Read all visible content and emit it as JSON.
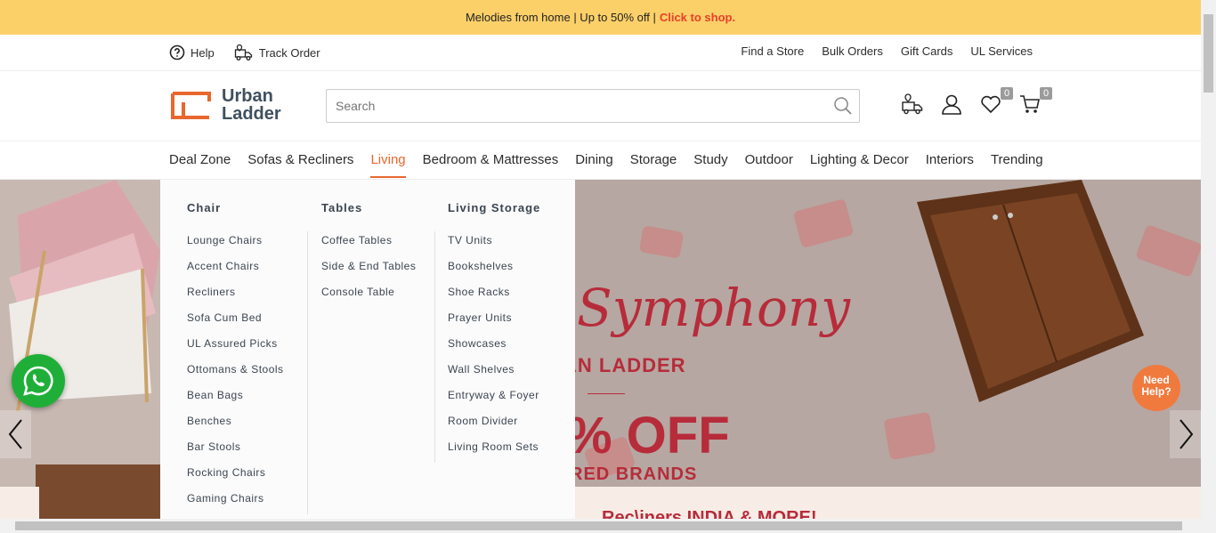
{
  "promo": {
    "text": "Melodies from home | Up to 50% off |",
    "cta": "Click to shop."
  },
  "util": {
    "help": "Help",
    "track_order": "Track Order",
    "links": [
      "Find a Store",
      "Bulk Orders",
      "Gift Cards",
      "UL Services"
    ]
  },
  "logo": {
    "line1": "Urban",
    "line2": "Ladder"
  },
  "search": {
    "placeholder": "Search"
  },
  "header_icons": {
    "wishlist_count": "0",
    "cart_count": "0"
  },
  "nav": {
    "items": [
      "Deal Zone",
      "Sofas & Recliners",
      "Living",
      "Bedroom & Mattresses",
      "Dining",
      "Storage",
      "Study",
      "Outdoor",
      "Lighting & Decor",
      "Interiors",
      "Trending"
    ],
    "active": "Living"
  },
  "mega_menu": {
    "columns": [
      {
        "title": "Chair",
        "items": [
          "Lounge Chairs",
          "Accent Chairs",
          "Recliners",
          "Sofa Cum Bed",
          "UL Assured Picks",
          "Ottomans & Stools",
          "Bean Bags",
          "Benches",
          "Bar Stools",
          "Rocking Chairs",
          "Gaming Chairs"
        ]
      },
      {
        "title": "Tables",
        "items": [
          "Coffee Tables",
          "Side & End Tables",
          "Console Table"
        ]
      },
      {
        "title": "Living Storage",
        "items": [
          "TV Units",
          "Bookshelves",
          "Shoe Racks",
          "Prayer Units",
          "Showcases",
          "Wall Shelves",
          "Entryway & Foyer",
          "Room Divider",
          "Living Room Sets"
        ]
      }
    ]
  },
  "banner": {
    "script": "Symphony",
    "brand": "AN LADDER",
    "offer": "% OFF",
    "sub": "RED BRANDS",
    "bottom": "Rec\\iners INDIA & MORE!"
  },
  "help_bubble": {
    "line1": "Need",
    "line2": "Help?"
  },
  "colors": {
    "promo_bg": "#fcd069",
    "accent": "#e8672e",
    "cta": "#e8402a",
    "whatsapp": "#1faf38"
  }
}
